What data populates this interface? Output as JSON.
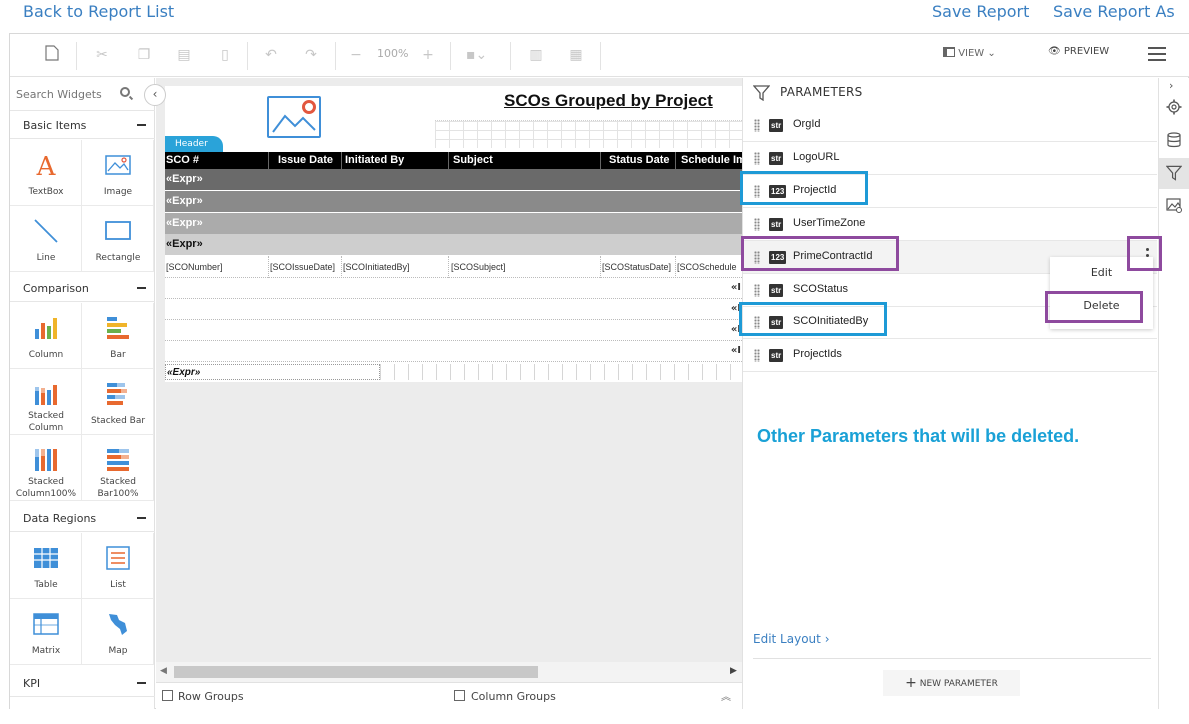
{
  "top": {
    "back": "Back to Report List",
    "save": "Save Report",
    "save_as": "Save Report As"
  },
  "toolbar": {
    "zoom": "100%",
    "view": "VIEW",
    "preview": "PREVIEW"
  },
  "widgets": {
    "search_placeholder": "Search Widgets",
    "sections": [
      "Basic Items",
      "Comparison",
      "Data Regions",
      "KPI"
    ],
    "basic": [
      "TextBox",
      "Image",
      "Line",
      "Rectangle"
    ],
    "comparison": [
      "Column",
      "Bar",
      "Stacked Column",
      "Stacked Bar",
      "Stacked Column100%",
      "Stacked Bar100%"
    ],
    "data_regions": [
      "Table",
      "List",
      "Matrix",
      "Map"
    ]
  },
  "report": {
    "title": "SCOs Grouped by Project",
    "header_tab": "Header",
    "columns": [
      "SCO #",
      "Issue Date",
      "Initiated By",
      "Subject",
      "Status Date",
      "Schedule Im"
    ],
    "expr": "«Expr»",
    "detail": [
      "[SCONumber]",
      "[SCOIssueDate]",
      "[SCOInitiatedBy]",
      "[SCOSubject]",
      "[SCOStatusDate]",
      "[SCOSchedule"
    ],
    "blank_mark": "«I",
    "footer_expr": "«Expr»"
  },
  "groups": {
    "row": "Row Groups",
    "column": "Column Groups"
  },
  "parameters": {
    "title": "PARAMETERS",
    "items": [
      {
        "type": "str",
        "name": "OrgId"
      },
      {
        "type": "str",
        "name": "LogoURL"
      },
      {
        "type": "123",
        "name": "ProjectId"
      },
      {
        "type": "str",
        "name": "UserTimeZone"
      },
      {
        "type": "123",
        "name": "PrimeContractId"
      },
      {
        "type": "str",
        "name": "SCOStatus"
      },
      {
        "type": "str",
        "name": "SCOInitiatedBy"
      },
      {
        "type": "str",
        "name": "ProjectIds"
      }
    ],
    "menu": {
      "edit": "Edit",
      "delete": "Delete"
    },
    "annotation": "Other Parameters that will be deleted.",
    "edit_layout": "Edit Layout",
    "new_param": "NEW PARAMETER"
  },
  "colors": {
    "link": "#3a7fc1",
    "highlight_blue": "#1e9ad6",
    "highlight_purple": "#8e4a9e",
    "header_tab": "#2aa3d9"
  }
}
